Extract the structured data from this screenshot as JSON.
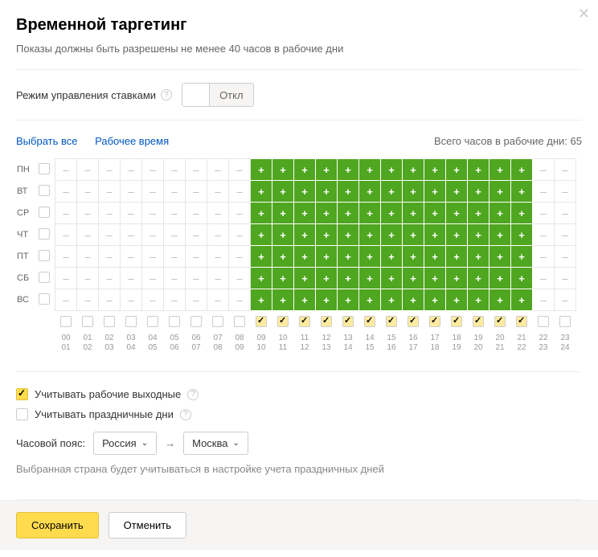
{
  "title": "Временной таргетинг",
  "subtitle": "Показы должны быть разрешены не менее 40 часов в рабочие дни",
  "mode": {
    "label": "Режим управления ставками",
    "toggle_label": "Откл"
  },
  "links": {
    "select_all": "Выбрать все",
    "working_hours": "Рабочее время"
  },
  "total": {
    "prefix": "Всего часов в рабочие дни: ",
    "value": "65"
  },
  "days": [
    "ПН",
    "ВТ",
    "СР",
    "ЧТ",
    "ПТ",
    "СБ",
    "ВС"
  ],
  "hours": [
    {
      "top": "00",
      "bot": "01"
    },
    {
      "top": "01",
      "bot": "02"
    },
    {
      "top": "02",
      "bot": "03"
    },
    {
      "top": "03",
      "bot": "04"
    },
    {
      "top": "04",
      "bot": "05"
    },
    {
      "top": "05",
      "bot": "06"
    },
    {
      "top": "06",
      "bot": "07"
    },
    {
      "top": "07",
      "bot": "08"
    },
    {
      "top": "08",
      "bot": "09"
    },
    {
      "top": "09",
      "bot": "10"
    },
    {
      "top": "10",
      "bot": "11"
    },
    {
      "top": "11",
      "bot": "12"
    },
    {
      "top": "12",
      "bot": "13"
    },
    {
      "top": "13",
      "bot": "14"
    },
    {
      "top": "14",
      "bot": "15"
    },
    {
      "top": "15",
      "bot": "16"
    },
    {
      "top": "16",
      "bot": "17"
    },
    {
      "top": "17",
      "bot": "18"
    },
    {
      "top": "18",
      "bot": "19"
    },
    {
      "top": "19",
      "bot": "20"
    },
    {
      "top": "20",
      "bot": "21"
    },
    {
      "top": "21",
      "bot": "22"
    },
    {
      "top": "22",
      "bot": "23"
    },
    {
      "top": "23",
      "bot": "24"
    }
  ],
  "schedule": [
    [
      0,
      0,
      0,
      0,
      0,
      0,
      0,
      0,
      0,
      1,
      1,
      1,
      1,
      1,
      1,
      1,
      1,
      1,
      1,
      1,
      1,
      1,
      0,
      0
    ],
    [
      0,
      0,
      0,
      0,
      0,
      0,
      0,
      0,
      0,
      1,
      1,
      1,
      1,
      1,
      1,
      1,
      1,
      1,
      1,
      1,
      1,
      1,
      0,
      0
    ],
    [
      0,
      0,
      0,
      0,
      0,
      0,
      0,
      0,
      0,
      1,
      1,
      1,
      1,
      1,
      1,
      1,
      1,
      1,
      1,
      1,
      1,
      1,
      0,
      0
    ],
    [
      0,
      0,
      0,
      0,
      0,
      0,
      0,
      0,
      0,
      1,
      1,
      1,
      1,
      1,
      1,
      1,
      1,
      1,
      1,
      1,
      1,
      1,
      0,
      0
    ],
    [
      0,
      0,
      0,
      0,
      0,
      0,
      0,
      0,
      0,
      1,
      1,
      1,
      1,
      1,
      1,
      1,
      1,
      1,
      1,
      1,
      1,
      1,
      0,
      0
    ],
    [
      0,
      0,
      0,
      0,
      0,
      0,
      0,
      0,
      0,
      1,
      1,
      1,
      1,
      1,
      1,
      1,
      1,
      1,
      1,
      1,
      1,
      1,
      0,
      0
    ],
    [
      0,
      0,
      0,
      0,
      0,
      0,
      0,
      0,
      0,
      1,
      1,
      1,
      1,
      1,
      1,
      1,
      1,
      1,
      1,
      1,
      1,
      1,
      0,
      0
    ]
  ],
  "hour_checks": [
    0,
    0,
    0,
    0,
    0,
    0,
    0,
    0,
    0,
    1,
    1,
    1,
    1,
    1,
    1,
    1,
    1,
    1,
    1,
    1,
    1,
    1,
    0,
    0
  ],
  "options": {
    "working_weekends": {
      "label": "Учитывать рабочие выходные",
      "checked": true
    },
    "holidays": {
      "label": "Учитывать праздничные дни",
      "checked": false
    }
  },
  "timezone": {
    "label": "Часовой пояс:",
    "country": "Россия",
    "city": "Москва",
    "note": "Выбранная страна будет учитываться в настройке учета праздничных дней"
  },
  "footer": {
    "save": "Сохранить",
    "cancel": "Отменить"
  }
}
